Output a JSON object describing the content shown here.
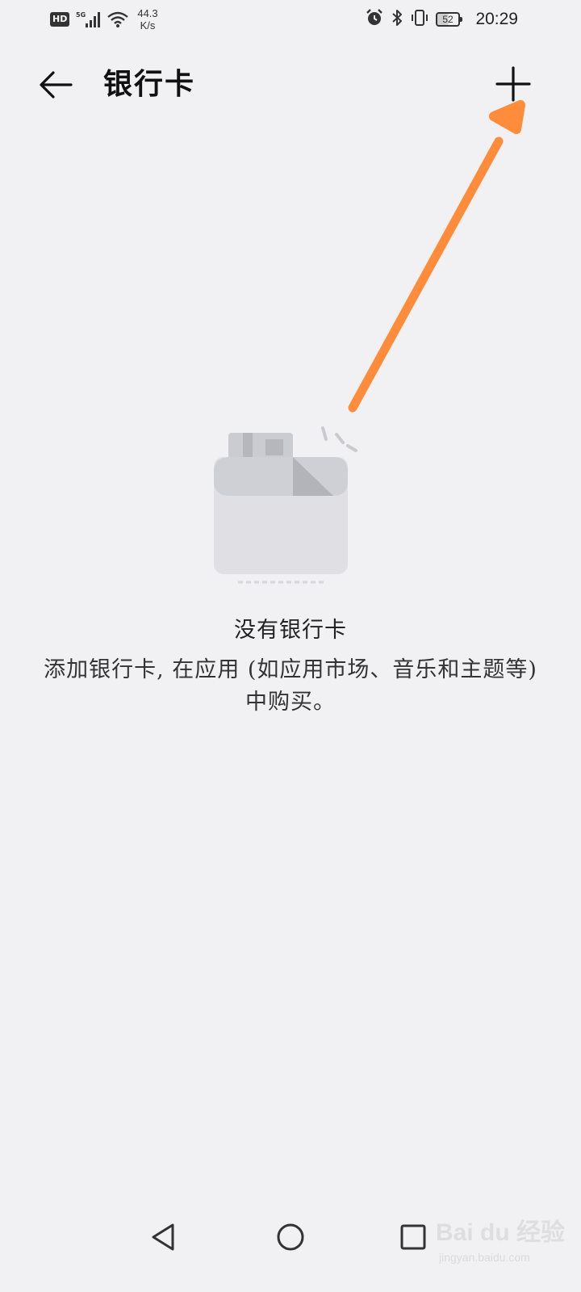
{
  "status_bar": {
    "network_badge": "HD",
    "network_type": "5G",
    "speed_value": "44.3",
    "speed_unit": "K/s",
    "battery_level": "52",
    "time": "20:29"
  },
  "header": {
    "title": "银行卡",
    "back_icon": "arrow-left-icon",
    "add_icon": "plus-icon"
  },
  "empty_state": {
    "illustration_icon": "wallet-card-icon",
    "title": "没有银行卡",
    "description": "添加银行卡, 在应用 (如应用市场、音乐和主题等) 中购买。"
  },
  "annotation": {
    "color": "#ff8c3a"
  },
  "nav_bar": {
    "back_icon": "triangle-back-icon",
    "home_icon": "circle-home-icon",
    "recent_icon": "square-recent-icon"
  },
  "watermark": {
    "logo": "Bai du 经验",
    "sub": "jingyan.baidu.com"
  }
}
